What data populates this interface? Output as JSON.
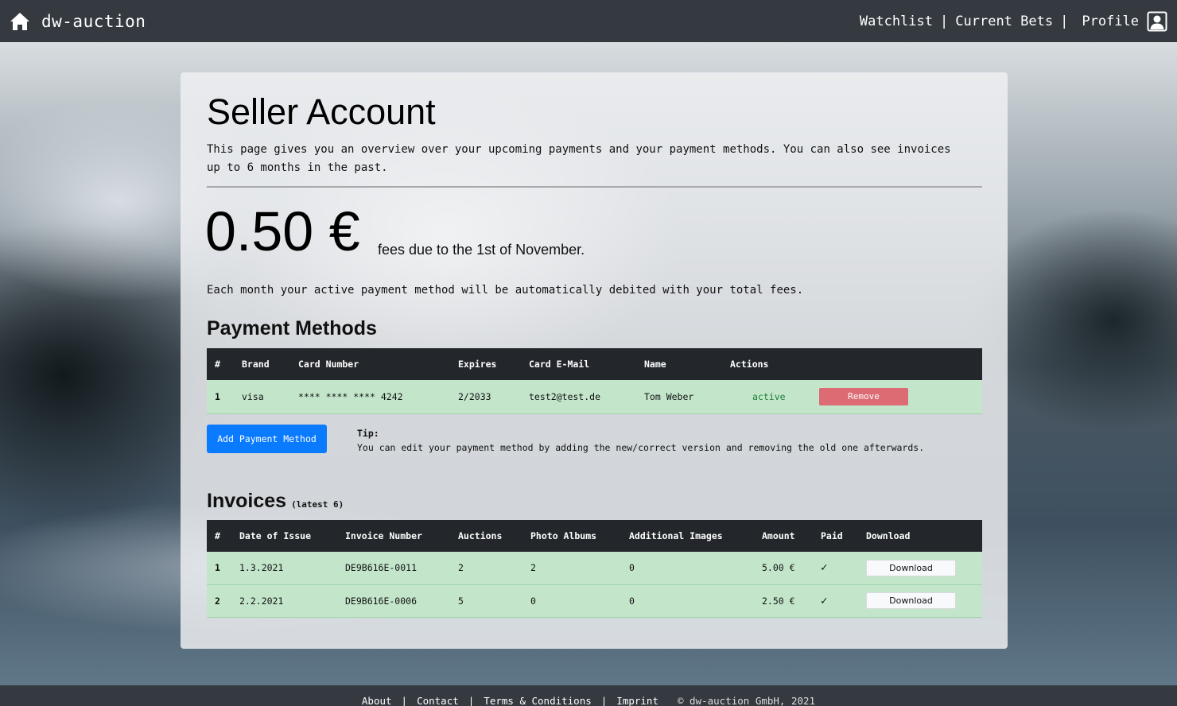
{
  "navbar": {
    "brand": "dw-auction",
    "links": {
      "watchlist": "Watchlist",
      "current_bets": "Current Bets",
      "profile": "Profile"
    },
    "separator": "|"
  },
  "page": {
    "title": "Seller Account",
    "intro": "This page gives you an overview over your upcoming payments and your payment methods. You can also see invoices up to 6 months in the past.",
    "fee_amount": "0.50 €",
    "fee_text": "fees due to the 1st of November.",
    "debit_note": "Each month your active payment method will be automatically debited with your total fees."
  },
  "payment_methods": {
    "title": "Payment Methods",
    "headers": [
      "#",
      "Brand",
      "Card Number",
      "Expires",
      "Card E-Mail",
      "Name",
      "Actions",
      ""
    ],
    "rows": [
      {
        "num": "1",
        "brand": "visa",
        "card_number": "**** **** **** 4242",
        "expires": "2/2033",
        "email": "test2@test.de",
        "name": "Tom Weber",
        "status": "active",
        "remove_label": "Remove"
      }
    ],
    "add_button": "Add Payment Method",
    "tip_label": "Tip:",
    "tip_text": "You can edit your payment method by adding the new/correct version and removing the old one afterwards."
  },
  "invoices": {
    "title": "Invoices",
    "subtitle": "(latest 6)",
    "headers": [
      "#",
      "Date of Issue",
      "Invoice Number",
      "Auctions",
      "Photo Albums",
      "Additional Images",
      "Amount",
      "Paid",
      "Download"
    ],
    "rows": [
      {
        "num": "1",
        "date": "1.3.2021",
        "invoice_number": "DE9B616E-0011",
        "auctions": "2",
        "photo_albums": "2",
        "additional_images": "0",
        "amount": "5.00 €",
        "paid": "✓",
        "download_label": "Download"
      },
      {
        "num": "2",
        "date": "2.2.2021",
        "invoice_number": "DE9B616E-0006",
        "auctions": "5",
        "photo_albums": "0",
        "additional_images": "0",
        "amount": "2.50 €",
        "paid": "✓",
        "download_label": "Download"
      }
    ]
  },
  "footer": {
    "links": [
      "About",
      "Contact",
      "Terms & Conditions",
      "Imprint"
    ],
    "separator": "|",
    "copyright": "© dw-auction GmbH, 2021"
  },
  "colors": {
    "navbar": "#343a40",
    "table_header": "#23272b",
    "row_success": "#c3e6cb",
    "primary": "#0a7bff",
    "danger": "#dc6b74",
    "active_text": "#1e7e34"
  }
}
